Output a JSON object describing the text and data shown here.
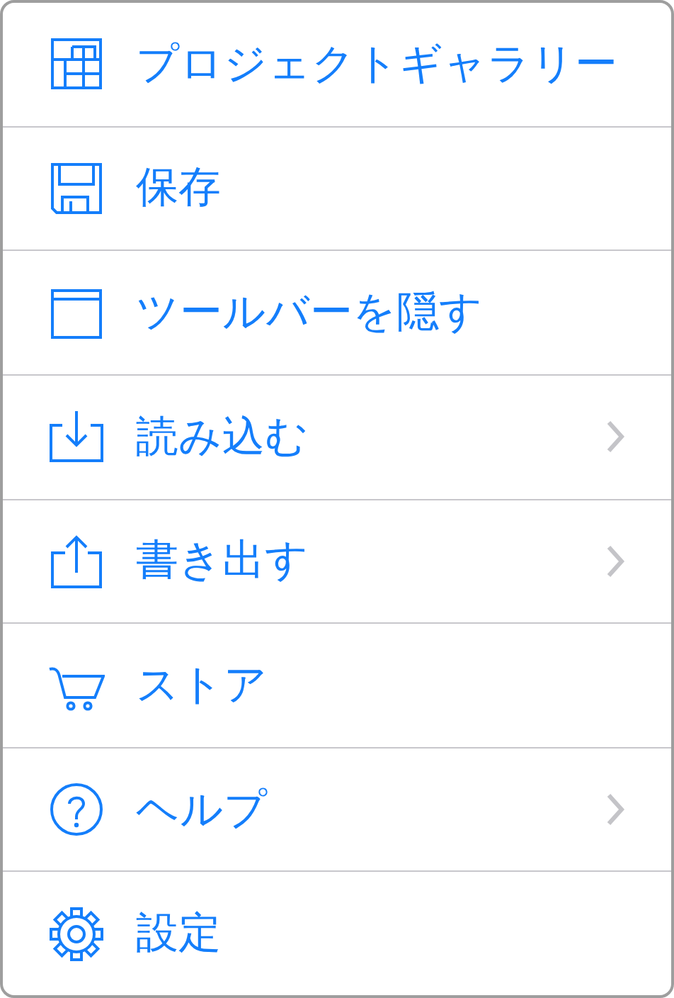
{
  "menu": {
    "items": [
      {
        "kind": "gallery",
        "label": "プロジェクトギャラリー",
        "has_submenu": false
      },
      {
        "kind": "save",
        "label": "保存",
        "has_submenu": false
      },
      {
        "kind": "window",
        "label": "ツールバーを隠す",
        "has_submenu": false
      },
      {
        "kind": "import",
        "label": "読み込む",
        "has_submenu": true
      },
      {
        "kind": "export",
        "label": "書き出す",
        "has_submenu": true
      },
      {
        "kind": "store",
        "label": "ストア",
        "has_submenu": false
      },
      {
        "kind": "help",
        "label": "ヘルプ",
        "has_submenu": true
      },
      {
        "kind": "settings",
        "label": "設定",
        "has_submenu": false
      }
    ]
  }
}
